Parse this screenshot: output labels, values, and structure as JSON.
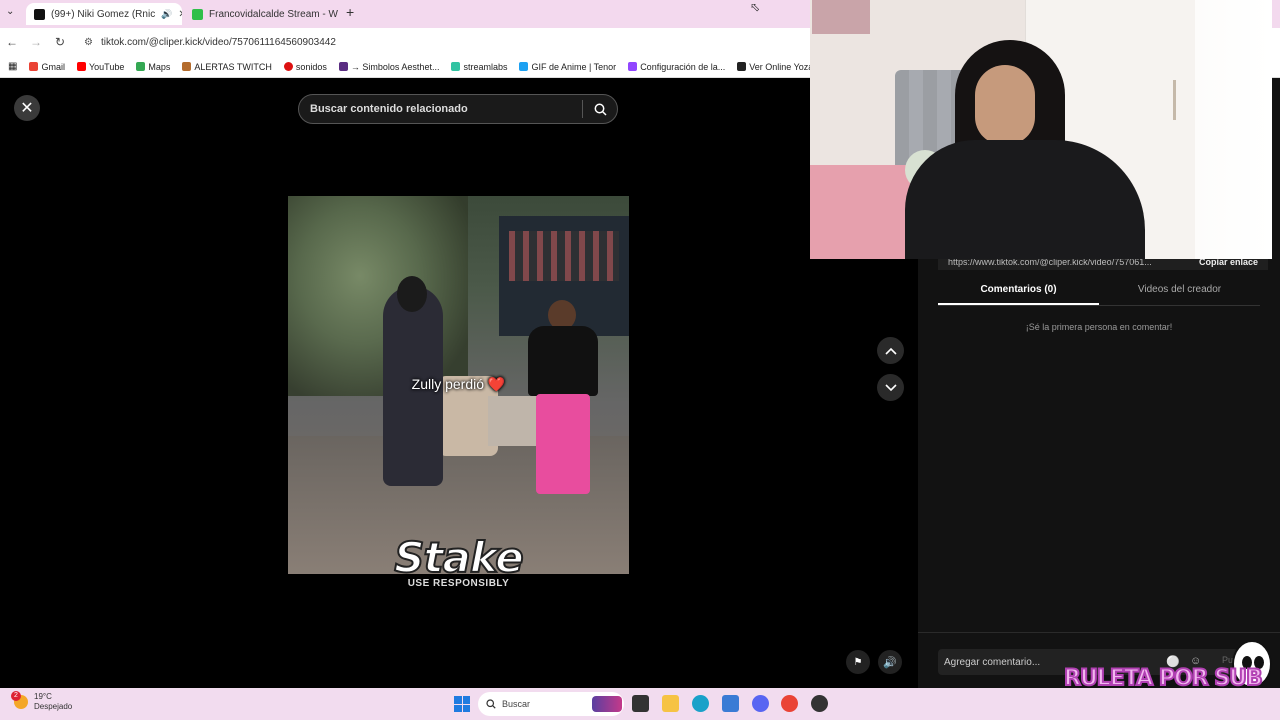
{
  "browser": {
    "tabs": [
      {
        "label": "(99+) Niki Gomez (Rnic",
        "color": "#111111",
        "active": true
      },
      {
        "label": "Francovidalcalde Stream - W",
        "color": "#2fbf4a",
        "active": false
      }
    ],
    "url": "tiktok.com/@cliper.kick/video/7570611164560903442",
    "bookmarks": [
      {
        "label": "Gmail",
        "color": "#ea4335"
      },
      {
        "label": "YouTube",
        "color": "#ff0000"
      },
      {
        "label": "Maps",
        "color": "#34a853"
      },
      {
        "label": "ALERTAS TWITCH",
        "color": "#b46c2d"
      },
      {
        "label": "sonidos",
        "color": "#d11"
      },
      {
        "label": "→ Simbolos Aesthet...",
        "color": "#5a2d82"
      },
      {
        "label": "streamlabs",
        "color": "#31c3a2"
      },
      {
        "label": "GIF de Anime | Tenor",
        "color": "#1da1f2"
      },
      {
        "label": "Configuración de la...",
        "color": "#9146ff"
      },
      {
        "label": "Ver Online Yozakura...",
        "color": "#222"
      }
    ]
  },
  "page": {
    "search_placeholder": "Buscar contenido relacionado",
    "caption": "Zully perdió",
    "caption_emoji": "❤️",
    "sponsor_logo": "Stake",
    "sponsor_sub": "USE RESPONSIBLY"
  },
  "panel": {
    "link": "https://www.tiktok.com/@cliper.kick/video/757061...",
    "copy_label": "Copiar enlace",
    "tab_comments": "Comentarios (0)",
    "tab_creator": "Videos del creador",
    "empty_text": "¡Sé la primera persona en comentar!",
    "comment_placeholder": "Agregar comentario...",
    "post_label": "Pu"
  },
  "taskbar": {
    "temp": "19°C",
    "weather": "Despejado",
    "search_label": "Buscar",
    "badge": "2"
  },
  "overlay": {
    "text": "RULETA POR SUB"
  }
}
